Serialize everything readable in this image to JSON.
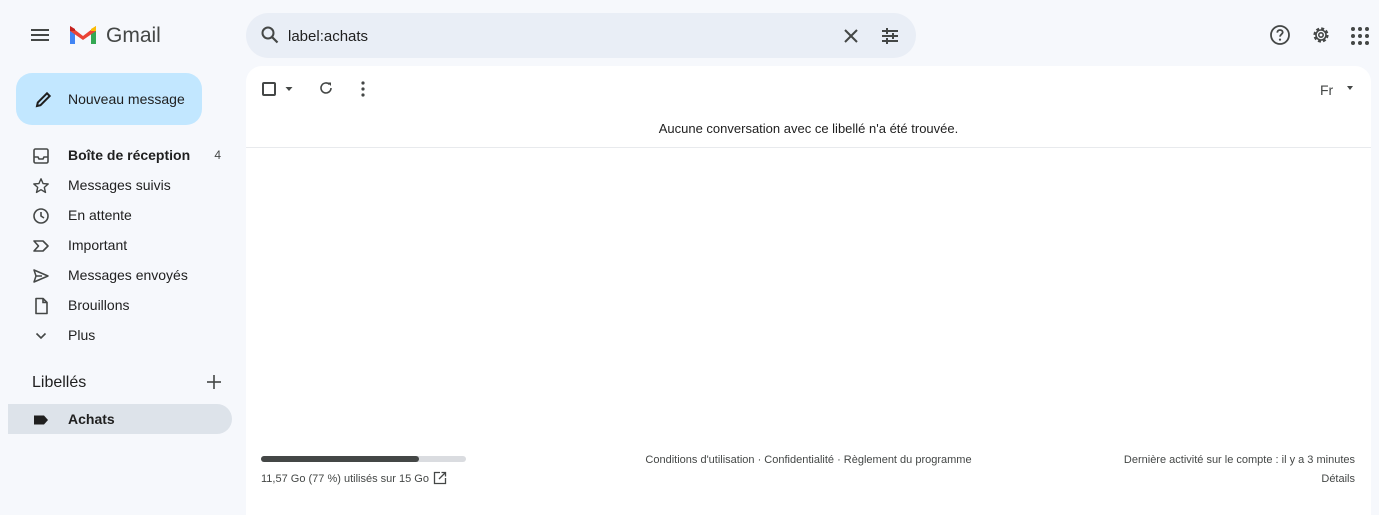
{
  "header": {
    "brand": "Gmail",
    "search_value": "label:achats"
  },
  "compose": {
    "label": "Nouveau message"
  },
  "nav": {
    "items": [
      {
        "label": "Boîte de réception",
        "count": "4",
        "icon": "inbox-icon"
      },
      {
        "label": "Messages suivis",
        "count": "",
        "icon": "star-icon"
      },
      {
        "label": "En attente",
        "count": "",
        "icon": "clock-icon"
      },
      {
        "label": "Important",
        "count": "",
        "icon": "important-icon"
      },
      {
        "label": "Messages envoyés",
        "count": "",
        "icon": "send-icon"
      },
      {
        "label": "Brouillons",
        "count": "",
        "icon": "draft-icon"
      },
      {
        "label": "Plus",
        "count": "",
        "icon": "chevron-down-icon"
      }
    ]
  },
  "labels": {
    "title": "Libellés",
    "items": [
      {
        "label": "Achats",
        "icon": "label-icon"
      }
    ]
  },
  "main": {
    "language": "Fr",
    "empty_message": "Aucune conversation avec ce libellé n'a été trouvée."
  },
  "footer": {
    "storage_text": "11,57 Go (77 %) utilisés sur 15 Go",
    "storage_fraction": 0.77,
    "links": "Conditions d'utilisation · Confidentialité · Règlement du programme",
    "last_activity": "Dernière activité sur le compte : il y a 3 minutes",
    "details": "Détails"
  },
  "colors": {
    "background": "#f6f8fc",
    "search_bg": "#e9eef6",
    "compose_bg": "#c2e7ff",
    "active_label_bg": "#dde3ea"
  }
}
